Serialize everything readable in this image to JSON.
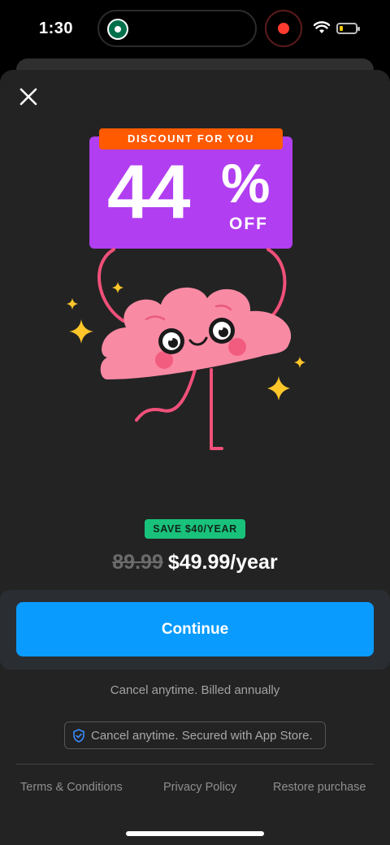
{
  "status_bar": {
    "time": "1:30"
  },
  "paywall": {
    "badge_tag": "DISCOUNT FOR YOU",
    "discount_value": "44",
    "percent_sign": "%",
    "off_label": "OFF",
    "save_pill": "SAVE $40/YEAR",
    "old_price": "89.99",
    "new_price": "$49.99/year",
    "continue_label": "Continue",
    "billing_note": "Cancel anytime. Billed annually",
    "secure_note": "Cancel anytime. Secured with App Store."
  },
  "footer": {
    "terms": "Terms & Conditions",
    "privacy": "Privacy Policy",
    "restore": "Restore purchase"
  },
  "colors": {
    "accent_blue": "#0a9bff",
    "badge_purple": "#b13ef0",
    "tag_orange": "#ff5a00",
    "save_green": "#19c27b",
    "sheet_bg": "#232323"
  },
  "icons": [
    "starbucks-icon",
    "recording-icon",
    "wifi-icon",
    "battery-icon",
    "close-icon",
    "shield-check-icon"
  ]
}
